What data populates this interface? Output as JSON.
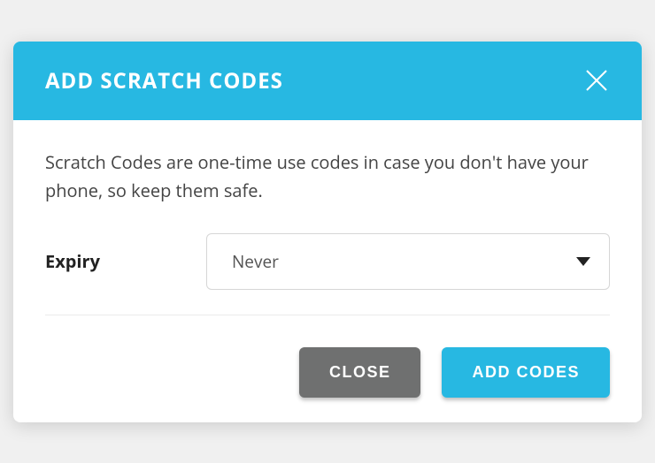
{
  "modal": {
    "title": "ADD SCRATCH CODES",
    "description": "Scratch Codes are one-time use codes in case you don't have your phone, so keep them safe.",
    "expiry": {
      "label": "Expiry",
      "selected": "Never"
    },
    "buttons": {
      "close": "CLOSE",
      "add": "ADD CODES"
    }
  },
  "colors": {
    "accent": "#27b8e2",
    "secondary": "#6f7070"
  }
}
